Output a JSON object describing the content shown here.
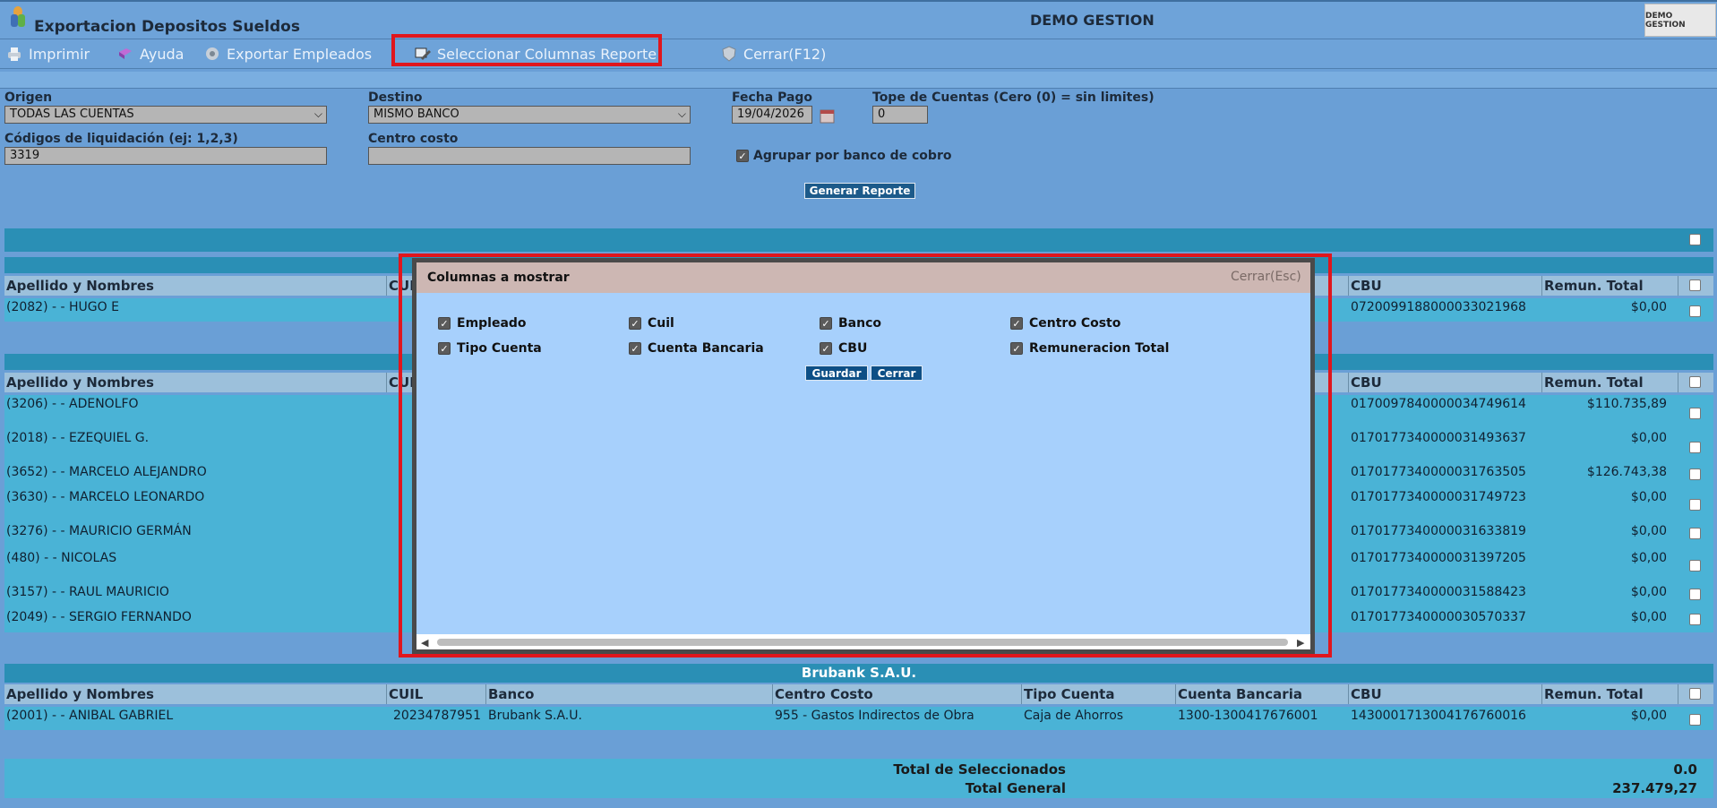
{
  "window": {
    "title": "Exportacion Depositos Sueldos",
    "company": "DEMO GESTION",
    "company_badge": "DEMO GESTION"
  },
  "toolbar": {
    "print": "Imprimir",
    "help": "Ayuda",
    "export": "Exportar Empleados",
    "select_columns": "Seleccionar Columnas Reporte",
    "close": "Cerrar(F12)"
  },
  "form": {
    "origen_label": "Origen",
    "origen_value": "TODAS LAS CUENTAS",
    "destino_label": "Destino",
    "destino_value": "MISMO BANCO",
    "fecha_label": "Fecha Pago",
    "fecha_value": "19/04/2026",
    "tope_label": "Tope de Cuentas (Cero (0) = sin limites)",
    "tope_value": "0",
    "codigos_label": "Códigos de liquidación (ej: 1,2,3)",
    "codigos_value": "3319",
    "centro_label": "Centro costo",
    "centro_value": "",
    "agrupar_label": "Agrupar por banco de cobro",
    "generar": "Generar Reporte"
  },
  "table": {
    "headers": {
      "nombre": "Apellido y Nombres",
      "cuil": "CUIL",
      "banco": "Banco",
      "centro": "Centro Costo",
      "tipo": "Tipo Cuenta",
      "cuenta": "Cuenta Bancaria",
      "cbu": "CBU",
      "remun": "Remun. Total"
    },
    "headers_partial": {
      "cuil": "CUI"
    },
    "group1_rows": [
      {
        "nombre": "(2082) - - HUGO E",
        "cbu": "0720099188000033021968",
        "remun": "$0,00"
      }
    ],
    "group2_rows": [
      {
        "nombre": "(3206) - - ADENOLFO",
        "cbu": "0170097840000034749614",
        "remun": "$110.735,89"
      },
      {
        "nombre": "(2018) - - EZEQUIEL G.",
        "cbu": "0170177340000031493637",
        "remun": "$0,00"
      },
      {
        "nombre": "(3652) - - MARCELO ALEJANDRO",
        "cbu": "0170177340000031763505",
        "remun": "$126.743,38"
      },
      {
        "nombre": "(3630) - - MARCELO LEONARDO",
        "cbu": "0170177340000031749723",
        "remun": "$0,00"
      },
      {
        "nombre": "(3276) - - MAURICIO GERMÁN",
        "cbu": "0170177340000031633819",
        "remun": "$0,00"
      },
      {
        "nombre": "(480) - - NICOLAS",
        "cbu": "0170177340000031397205",
        "remun": "$0,00"
      },
      {
        "nombre": "(3157) - - RAUL MAURICIO",
        "cbu": "0170177340000031588423",
        "remun": "$0,00"
      },
      {
        "nombre": "(2049) - - SERGIO FERNANDO",
        "cbu": "0170177340000030570337",
        "remun": "$0,00"
      }
    ],
    "group3_title": "Brubank S.A.U.",
    "group3_row": {
      "nombre": "(2001) - - ANIBAL GABRIEL",
      "cuil": "20234787951",
      "banco": "Brubank S.A.U.",
      "centro": "955 - Gastos Indirectos de Obra",
      "tipo": "Caja de Ahorros",
      "cuenta": "1300-1300417676001",
      "cbu": "1430001713004176760016",
      "remun": "$0,00"
    }
  },
  "totals": {
    "selected_label": "Total de Seleccionados",
    "selected_value": "0.0",
    "general_label": "Total General",
    "general_value": "237.479,27"
  },
  "dialog": {
    "title": "Columnas a mostrar",
    "close": "Cerrar(Esc)",
    "options": [
      "Empleado",
      "Cuil",
      "Banco",
      "Centro Costo",
      "Tipo Cuenta",
      "Cuenta Bancaria",
      "CBU",
      "Remuneracion Total"
    ],
    "save": "Guardar",
    "cancel": "Cerrar"
  },
  "colors": {
    "highlight": "#e0161d",
    "row": "#4ab3d6",
    "header": "#9cc0db",
    "dialog_bg": "#a7d0fc"
  }
}
